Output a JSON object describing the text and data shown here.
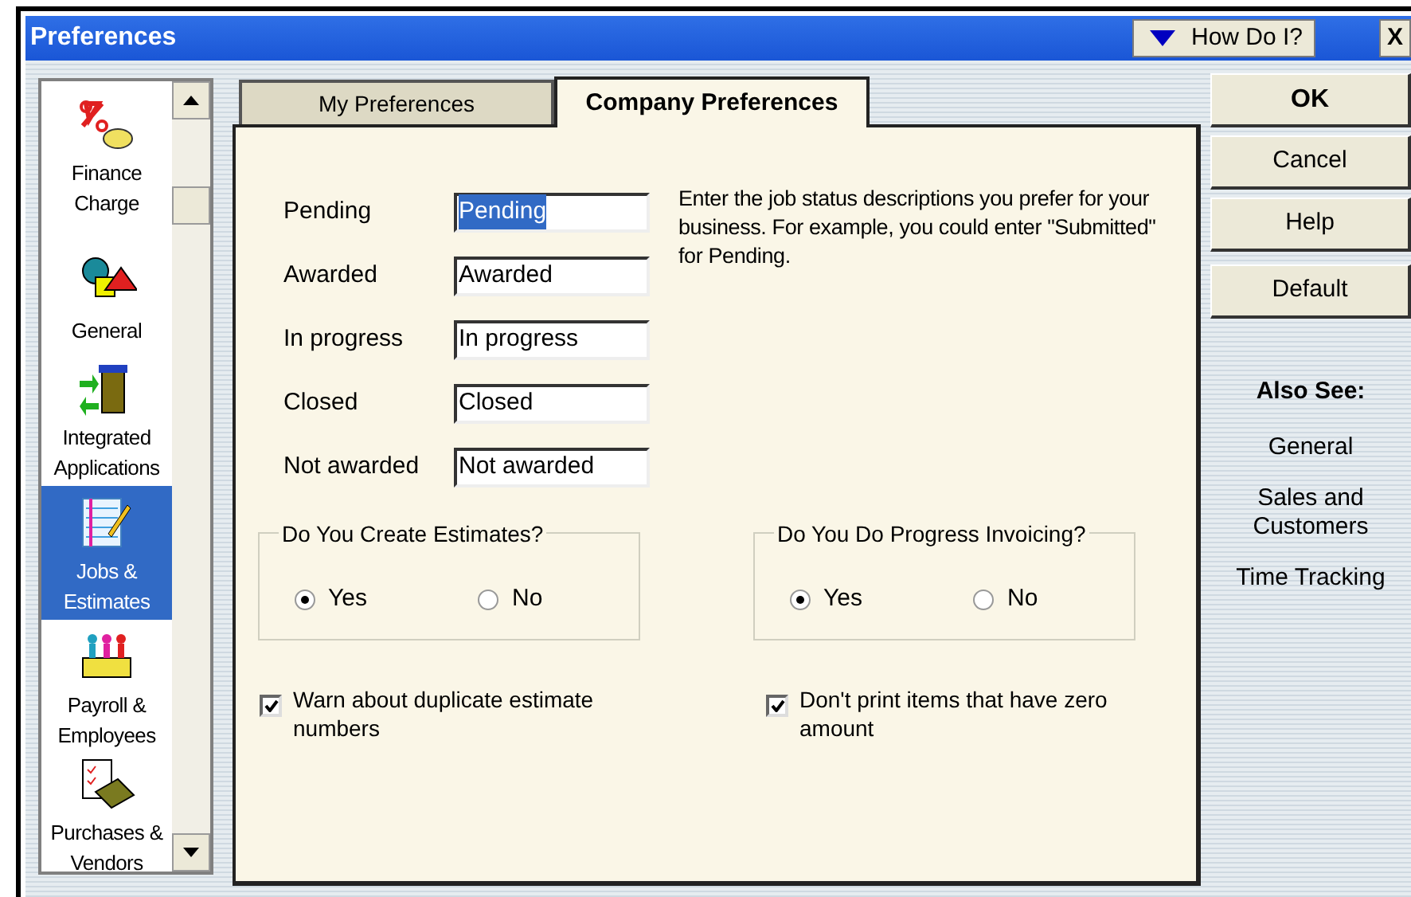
{
  "window": {
    "title": "Preferences",
    "help_button": "How Do I?",
    "close": "X"
  },
  "sidebar": {
    "items": [
      {
        "label": "Finance Charge",
        "selected": false
      },
      {
        "label": "General",
        "selected": false
      },
      {
        "label": "Integrated Applications",
        "selected": false
      },
      {
        "label": "Jobs & Estimates",
        "selected": true
      },
      {
        "label": "Payroll & Employees",
        "selected": false
      },
      {
        "label": "Purchases & Vendors",
        "selected": false
      }
    ]
  },
  "tabs": [
    {
      "label": "My Preferences",
      "selected": false
    },
    {
      "label": "Company Preferences",
      "selected": true
    }
  ],
  "status_fields": [
    {
      "label": "Pending",
      "value": "Pending",
      "text_selected": true
    },
    {
      "label": "Awarded",
      "value": "Awarded",
      "text_selected": false
    },
    {
      "label": "In progress",
      "value": "In progress",
      "text_selected": false
    },
    {
      "label": "Closed",
      "value": "Closed",
      "text_selected": false
    },
    {
      "label": "Not awarded",
      "value": "Not awarded",
      "text_selected": false
    }
  ],
  "description": "Enter the job status descriptions you prefer for your business.  For example, you could enter \"Submitted\" for Pending.",
  "option_groups": [
    {
      "title": "Do You Create Estimates?",
      "options": [
        {
          "label": "Yes",
          "selected": true
        },
        {
          "label": "No",
          "selected": false
        }
      ]
    },
    {
      "title": "Do You Do Progress Invoicing?",
      "options": [
        {
          "label": "Yes",
          "selected": true
        },
        {
          "label": "No",
          "selected": false
        }
      ]
    }
  ],
  "checkboxes": [
    {
      "label": "Warn about duplicate estimate numbers",
      "checked": true
    },
    {
      "label": "Don't print items that have zero amount",
      "checked": true
    }
  ],
  "buttons": [
    {
      "label": "OK",
      "default": true
    },
    {
      "label": "Cancel",
      "default": false
    },
    {
      "label": "Help",
      "default": false
    },
    {
      "label": "Default",
      "default": false
    }
  ],
  "also_see": {
    "title": "Also See:",
    "links": [
      "General",
      "Sales and Customers",
      "Time Tracking"
    ]
  }
}
